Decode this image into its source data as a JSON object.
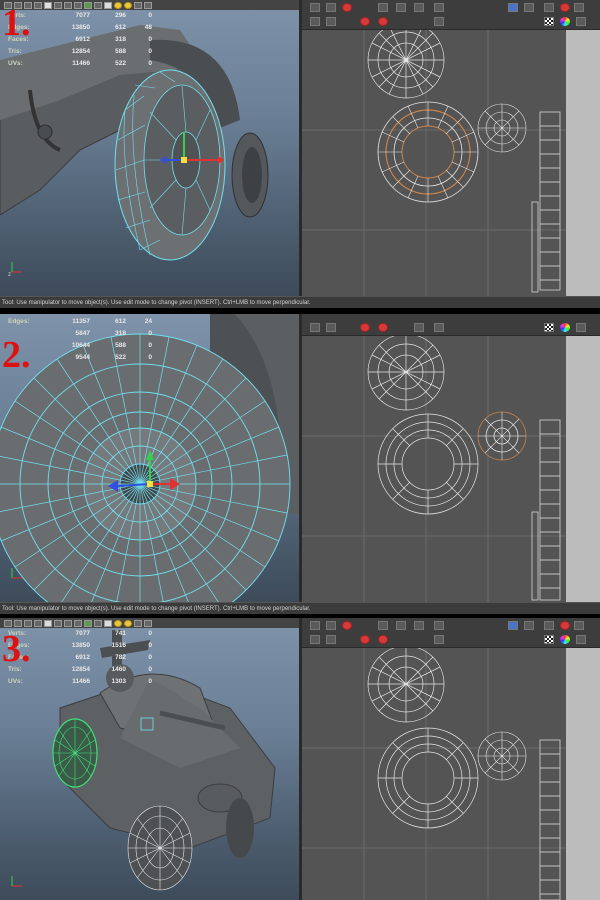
{
  "panels": [
    {
      "number": "1.",
      "stats": [
        {
          "label": "Verts:",
          "v1": "7077",
          "v2": "296",
          "v3": "0"
        },
        {
          "label": "Edges:",
          "v1": "13850",
          "v2": "612",
          "v3": "48"
        },
        {
          "label": "Faces:",
          "v1": "6912",
          "v2": "318",
          "v3": "0"
        },
        {
          "label": "Tris:",
          "v1": "12854",
          "v2": "588",
          "v3": "0"
        },
        {
          "label": "UVs:",
          "v1": "11466",
          "v2": "522",
          "v3": "0"
        }
      ],
      "status_text": "Tool: Use manipulator to move object(s). Use edit mode to change pivot (INSERT).  Ctrl+LMB to move perpendicular."
    },
    {
      "number": "2.",
      "stats": [
        {
          "label": "Edges:",
          "v1": "11357",
          "v2": "612",
          "v3": "24"
        },
        {
          "label": "",
          "v1": "5847",
          "v2": "318",
          "v3": "0"
        },
        {
          "label": "",
          "v1": "10644",
          "v2": "588",
          "v3": "0"
        },
        {
          "label": "",
          "v1": "9544",
          "v2": "522",
          "v3": "0"
        }
      ],
      "status_text": "Tool: Use manipulator to move object(s). Use edit mode to change pivot (INSERT).  Ctrl+LMB to move perpendicular."
    },
    {
      "number": "3.",
      "stats": [
        {
          "label": "Verts:",
          "v1": "7077",
          "v2": "741",
          "v3": "0"
        },
        {
          "label": "Edges:",
          "v1": "13850",
          "v2": "1516",
          "v3": "0"
        },
        {
          "label": "Faces:",
          "v1": "6912",
          "v2": "782",
          "v3": "0"
        },
        {
          "label": "Tris:",
          "v1": "12854",
          "v2": "1460",
          "v3": "0"
        },
        {
          "label": "UVs:",
          "v1": "11466",
          "v2": "1303",
          "v3": "0"
        }
      ]
    }
  ],
  "colors": {
    "wireframe_cyan": "#6fe0f0",
    "selected_orange": "#c8834a",
    "uv_white": "#e6e6e6",
    "highlight_green": "#3fe07a"
  }
}
